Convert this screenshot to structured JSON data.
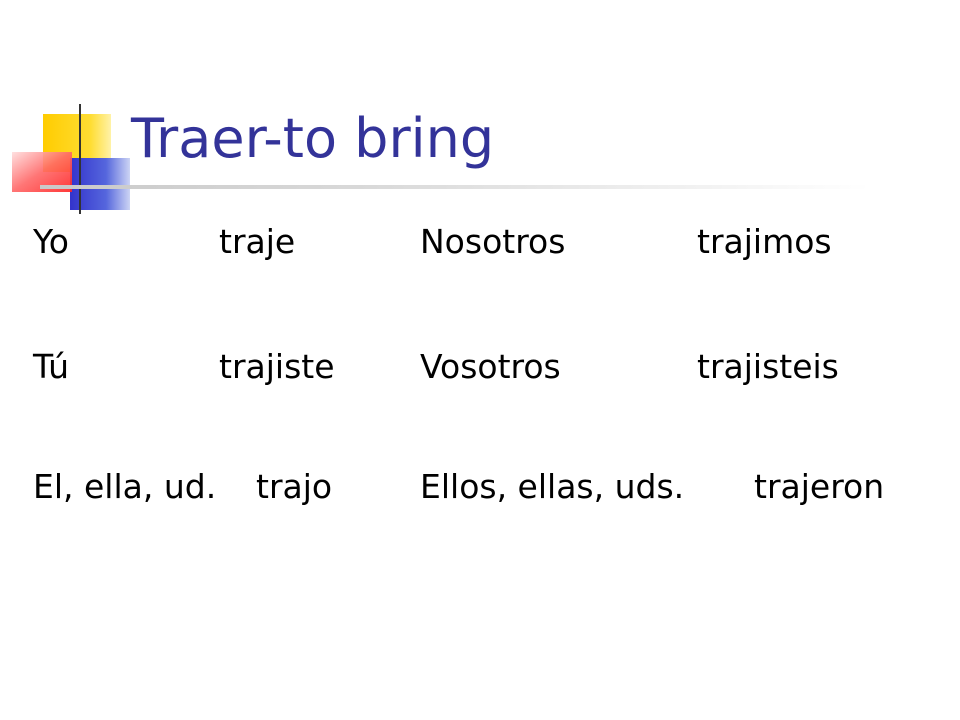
{
  "slide": {
    "title": "Traer-to bring",
    "colors": {
      "title": "#333399",
      "text": "#000000",
      "logo_yellow": "#ffcc00",
      "logo_blue": "#3333cc",
      "logo_red": "#ff3333"
    },
    "logo_icon": "layered-squares-logo-icon",
    "rows": [
      {
        "singular_pronoun": "Yo",
        "singular_verb": "traje",
        "plural_pronoun": "Nosotros",
        "plural_verb": "trajimos"
      },
      {
        "singular_pronoun": "Tú",
        "singular_verb": "trajiste",
        "plural_pronoun": "Vosotros",
        "plural_verb": "trajisteis"
      },
      {
        "singular_pronoun": "El, ella, ud.",
        "singular_verb": "trajo",
        "plural_pronoun": "Ellos, ellas, uds.",
        "plural_verb": "trajeron"
      }
    ]
  }
}
